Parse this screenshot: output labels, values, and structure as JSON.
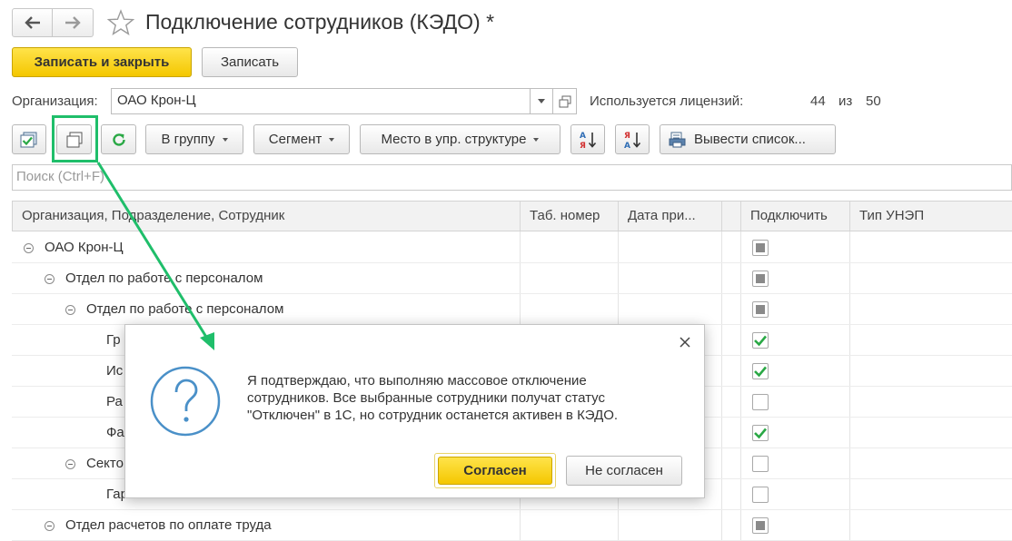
{
  "header": {
    "title": "Подключение сотрудников (КЭДО) *"
  },
  "commands": {
    "save_close": "Записать и закрыть",
    "save": "Записать"
  },
  "organization": {
    "label": "Организация:",
    "value": "ОАО Крон-Ц"
  },
  "license": {
    "label": "Используется лицензий:",
    "used": "44",
    "of": "из",
    "total": "50"
  },
  "toolbar": {
    "group": "В группу",
    "segment": "Сегмент",
    "place": "Место в упр. структуре",
    "print_list": "Вывести список..."
  },
  "search": {
    "placeholder": "Поиск (Ctrl+F)"
  },
  "table": {
    "columns": [
      "Организация, Подразделение, Сотрудник",
      "Таб. номер",
      "Дата при...",
      "",
      "Подключить",
      "Тип УНЭП"
    ],
    "rows": [
      {
        "name": "ОАО Крон-Ц",
        "checkbox": "mixed"
      },
      {
        "name": "Отдел по работе с персоналом",
        "checkbox": "mixed"
      },
      {
        "name": "Отдел по работе с персоналом",
        "checkbox": "mixed"
      },
      {
        "name": "Гр",
        "checkbox": "checked"
      },
      {
        "name": "Ис",
        "checkbox": "checked"
      },
      {
        "name": "Ра",
        "checkbox": "unchecked"
      },
      {
        "name": "Фа",
        "checkbox": "checked"
      },
      {
        "name": "Секто",
        "checkbox": "unchecked"
      },
      {
        "name": "Гар",
        "checkbox": "unchecked"
      },
      {
        "name": "Отдел расчетов по оплате труда",
        "checkbox": "mixed"
      }
    ]
  },
  "dialog": {
    "lines": [
      "Я подтверждаю, что выполняю массовое отключение",
      "сотрудников. Все выбранные сотрудники получат статус",
      "\"Отключен\" в 1С, но сотрудник останется активен в КЭДО."
    ],
    "agree": "Согласен",
    "disagree": "Не согласен"
  },
  "colors": {
    "accent_yellow": "#f4c700",
    "highlight_green": "#1fbe6a",
    "check_green": "#2aa845",
    "dialog_icon_blue": "#4a90c8"
  }
}
